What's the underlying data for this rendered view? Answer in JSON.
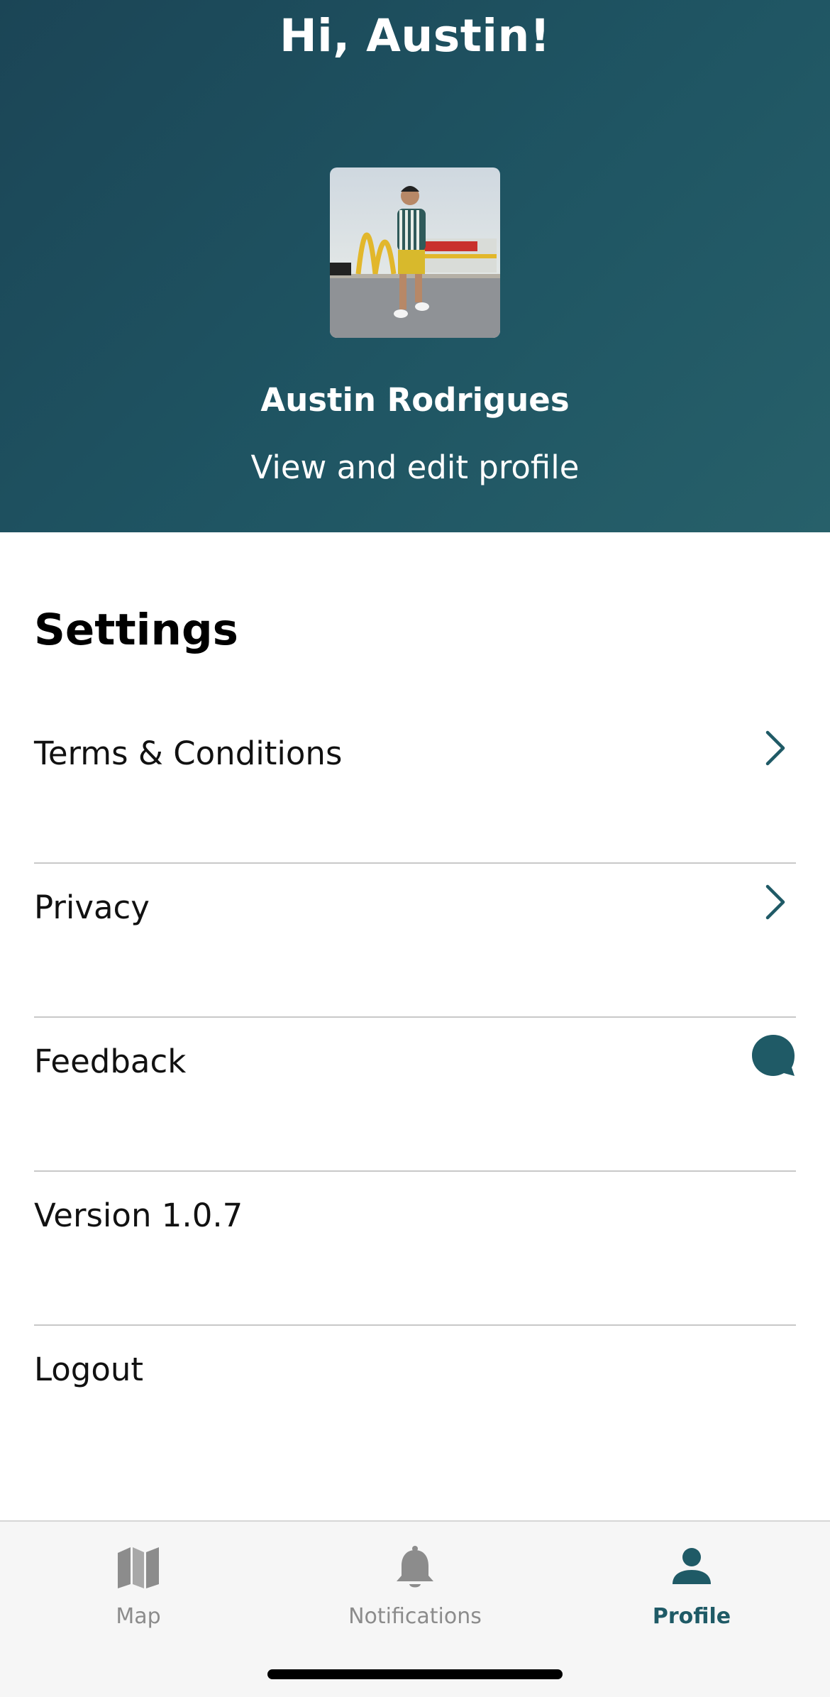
{
  "colors": {
    "header_gradient_start": "#1b4556",
    "header_gradient_end": "#27606a",
    "accent": "#1f5a66",
    "inactive_tab": "#8c8c8c",
    "divider": "#c8c8c8"
  },
  "header": {
    "greeting": "Hi, Austin!",
    "user_name": "Austin Rodrigues",
    "edit_link": "View and edit profile"
  },
  "settings": {
    "title": "Settings",
    "items": [
      {
        "label": "Terms & Conditions",
        "icon": "chevron-right-icon"
      },
      {
        "label": "Privacy",
        "icon": "chevron-right-icon"
      },
      {
        "label": "Feedback",
        "icon": "chat-bubble-icon"
      },
      {
        "label": "Version 1.0.7",
        "icon": ""
      },
      {
        "label": "Logout",
        "icon": ""
      }
    ]
  },
  "tabbar": {
    "active": "Profile",
    "tabs": [
      {
        "label": "Map",
        "icon": "map-icon"
      },
      {
        "label": "Notifications",
        "icon": "bell-icon"
      },
      {
        "label": "Profile",
        "icon": "person-icon"
      }
    ]
  }
}
